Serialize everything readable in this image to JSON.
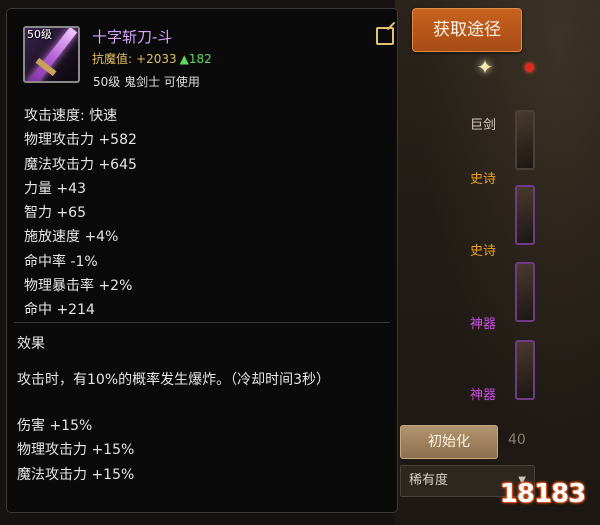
{
  "item": {
    "level_badge": "50级",
    "name": "十字斩刀-斗",
    "resist_label": "抗魔值:",
    "resist_value": "+2033",
    "resist_arrow": "▲",
    "resist_delta": "182",
    "requirement": "50级 鬼剑士 可使用"
  },
  "stats": [
    "攻击速度: 快速",
    "物理攻击力 +582",
    "魔法攻击力 +645",
    "力量 +43",
    "智力 +65",
    "施放速度 +4%",
    "命中率 -1%",
    "物理暴击率 +2%",
    "命中 +214"
  ],
  "effect": {
    "title": "效果",
    "description": "攻击时，有10%的概率发生爆炸。（冷却时间3秒）",
    "stats": [
      "伤害 +15%",
      "物理攻击力 +15%",
      "魔法攻击力 +15%"
    ]
  },
  "acquire_button": "获取途径",
  "background": {
    "rows": [
      "巨剑",
      "史诗",
      "史诗",
      "神器",
      "神器"
    ],
    "button": "初始化",
    "sort_label": "稀有度",
    "number_fragment": "40"
  },
  "watermark": "18183",
  "colors": {
    "item_name": "#d6a6ff",
    "resist": "#e0c060",
    "increase": "#5fd85f",
    "epic": "#f0a020",
    "artifact": "#c94fe0",
    "acquire_button": "#c8621f"
  }
}
